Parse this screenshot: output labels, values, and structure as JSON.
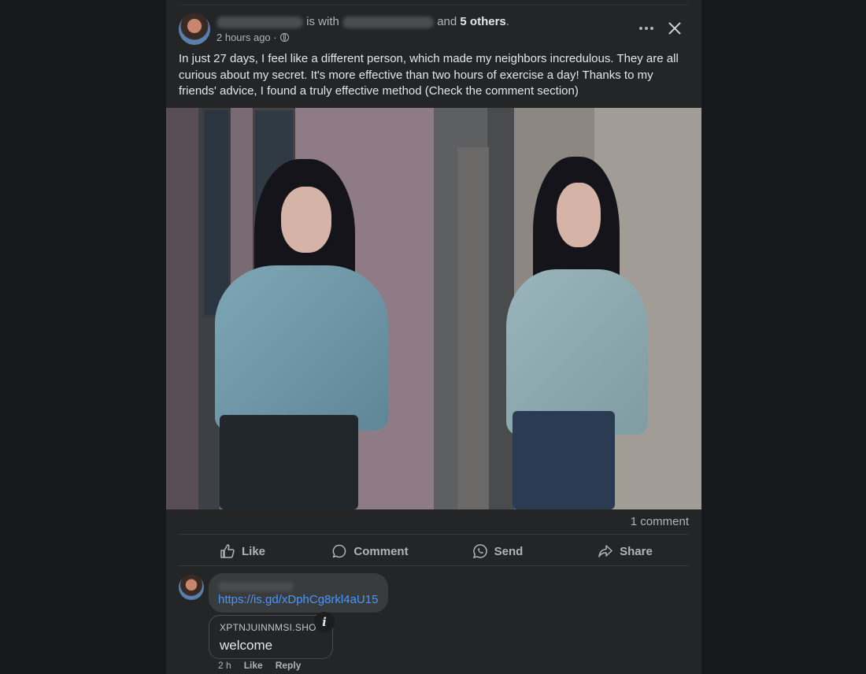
{
  "post": {
    "with_text": "is with",
    "and_text": "and",
    "others_text": "5 others",
    "timestamp": "2 hours ago ·",
    "body": "In just 27 days, I feel like a different person, which made my neighbors incredulous. They are all curious about my secret. It's more effective than two hours of exercise a day! Thanks to my friends' advice, I found a truly effective method  (Check the comment section)",
    "comment_count": "1 comment",
    "privacy_icon": "globe-icon"
  },
  "actions": {
    "like": "Like",
    "comment": "Comment",
    "send": "Send",
    "share": "Share"
  },
  "comment": {
    "link": "https://is.gd/xDphCg8rkl4aU15",
    "preview_domain": "XPTNJUINNMSI.SHO",
    "preview_title": "welcome",
    "info_glyph": "i",
    "time": "2 h",
    "like": "Like",
    "reply": "Reply"
  },
  "colors": {
    "background": "#1b1c1e",
    "card": "#242526",
    "link": "#4599ff",
    "text": "#e4e6eb",
    "muted": "#b0b3b8"
  }
}
